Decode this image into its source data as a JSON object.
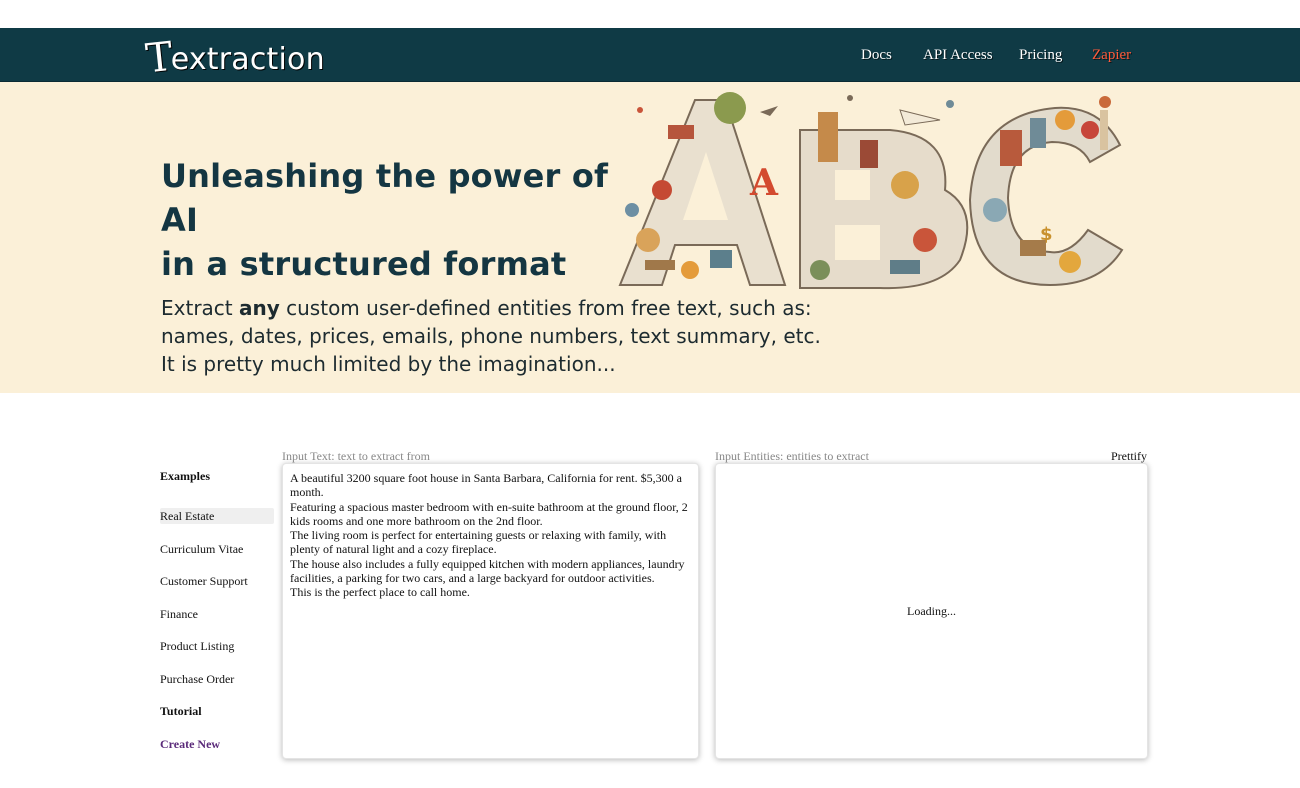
{
  "header": {
    "logo_first": "T",
    "logo_rest": "extraction",
    "nav": [
      {
        "label": "Docs"
      },
      {
        "label": "API Access"
      },
      {
        "label": "Pricing"
      },
      {
        "label": "Zapier",
        "color": "#ff5a3a"
      }
    ],
    "background": "#0f3a45"
  },
  "hero": {
    "headline_line1": "Unleashing the power of AI",
    "headline_line2": "in a structured format",
    "tagline_pre": "Extract ",
    "tagline_bold": "any",
    "tagline_post": " custom user-defined entities from free text, such as:",
    "tagline_line2": "names, dates, prices, emails, phone numbers, text summary, etc.",
    "tagline_line3": "It is pretty much limited by the imagination...",
    "art_letters": [
      "A",
      "B",
      "C"
    ],
    "background": "#fbf0d8"
  },
  "sidebar": {
    "examples_heading": "Examples",
    "items": [
      "Real Estate",
      "Curriculum Vitae",
      "Customer Support",
      "Finance",
      "Product Listing",
      "Purchase Order"
    ],
    "active_item": "Real Estate",
    "tutorial": "Tutorial",
    "create_new": "Create New"
  },
  "input_text": {
    "label": "Input Text: text to extract from",
    "value": "A beautiful 3200 square foot house in Santa Barbara, California for rent. $5,300 a month.\nFeaturing a spacious master bedroom with en-suite bathroom at the ground floor, 2 kids rooms and one more bathroom on the 2nd floor.\nThe living room is perfect for entertaining guests or relaxing with family, with plenty of natural light and a cozy fireplace.\nThe house also includes a fully equipped kitchen with modern appliances, laundry facilities, a parking for two cars, and a large backyard for outdoor activities.\nThis is the perfect place to call home."
  },
  "input_entities": {
    "label": "Input Entities: entities to extract",
    "prettify": "Prettify",
    "status": "Loading..."
  }
}
